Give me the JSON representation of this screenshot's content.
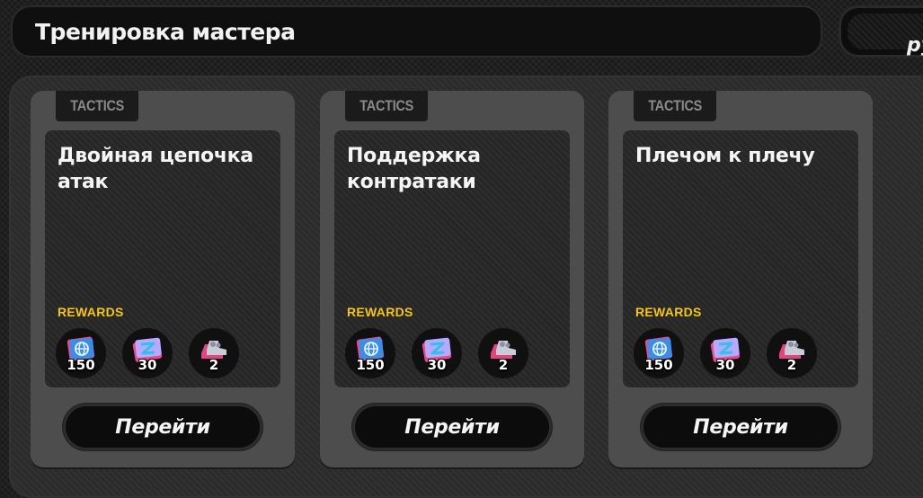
{
  "header": {
    "title": "Тренировка мастера",
    "side_button_text": "ру"
  },
  "colors": {
    "rewards_label": "#f5c518",
    "card_bg": "#4d4d4d",
    "inner_bg": "#262626"
  },
  "cards": [
    {
      "tag": "TACTICS",
      "name": "Двойная цепочка атак",
      "rewards_label": "REWARDS",
      "rewards": [
        {
          "icon": "globe-ticket-icon",
          "count": "150"
        },
        {
          "icon": "training-ticket-icon",
          "count": "30"
        },
        {
          "icon": "boots-icon",
          "count": "2"
        }
      ],
      "button_label": "Перейти"
    },
    {
      "tag": "TACTICS",
      "name": "Поддержка контратаки",
      "rewards_label": "REWARDS",
      "rewards": [
        {
          "icon": "globe-ticket-icon",
          "count": "150"
        },
        {
          "icon": "training-ticket-icon",
          "count": "30"
        },
        {
          "icon": "boots-icon",
          "count": "2"
        }
      ],
      "button_label": "Перейти"
    },
    {
      "tag": "TACTICS",
      "name": "Плечом к плечу",
      "rewards_label": "REWARDS",
      "rewards": [
        {
          "icon": "globe-ticket-icon",
          "count": "150"
        },
        {
          "icon": "training-ticket-icon",
          "count": "30"
        },
        {
          "icon": "boots-icon",
          "count": "2"
        }
      ],
      "button_label": "Перейти"
    }
  ]
}
